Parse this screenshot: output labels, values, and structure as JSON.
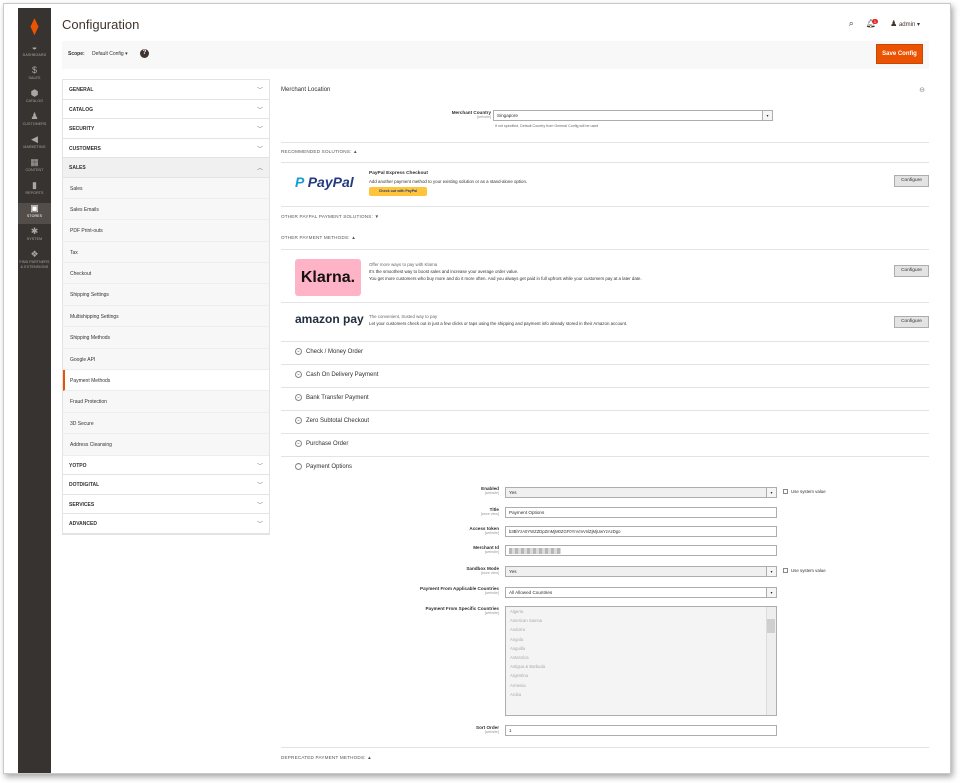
{
  "admin_nav": [
    {
      "icon": "dashboard-icon",
      "label": "DASHBOARD",
      "glyph": "◒"
    },
    {
      "icon": "sales-icon",
      "label": "SALES",
      "glyph": "$"
    },
    {
      "icon": "catalog-icon",
      "label": "CATALOG",
      "glyph": "⬢"
    },
    {
      "icon": "customers-icon",
      "label": "CUSTOMERS",
      "glyph": "♟"
    },
    {
      "icon": "marketing-icon",
      "label": "MARKETING",
      "glyph": "◀"
    },
    {
      "icon": "content-icon",
      "label": "CONTENT",
      "glyph": "▦"
    },
    {
      "icon": "reports-icon",
      "label": "REPORTS",
      "glyph": "▮"
    },
    {
      "icon": "stores-icon",
      "label": "STORES",
      "glyph": "▣"
    },
    {
      "icon": "system-icon",
      "label": "SYSTEM",
      "glyph": "✱"
    },
    {
      "icon": "partners-icon",
      "label": "FIND PARTNERS & EXTENSIONS",
      "glyph": "❖"
    }
  ],
  "header": {
    "title": "Configuration",
    "notifications_count": "1",
    "user": "admin"
  },
  "scope": {
    "label": "Scope:",
    "value": "Default Config",
    "save_label": "Save Config"
  },
  "config_nav": {
    "sections_top": [
      {
        "label": "GENERAL"
      },
      {
        "label": "CATALOG"
      },
      {
        "label": "SECURITY"
      },
      {
        "label": "CUSTOMERS"
      }
    ],
    "sales_label": "SALES",
    "sales_items": [
      "Sales",
      "Sales Emails",
      "PDF Print-outs",
      "Tax",
      "Checkout",
      "Shipping Settings",
      "Multishipping Settings",
      "Shipping Methods",
      "Google API",
      "Payment Methods",
      "Fraud Protection",
      "3D Secure",
      "Address Cleansing"
    ],
    "sections_bottom": [
      {
        "label": "YOTPO"
      },
      {
        "label": "DOTDIGITAL"
      },
      {
        "label": "SERVICES"
      },
      {
        "label": "ADVANCED"
      }
    ]
  },
  "main": {
    "merchant_location_title": "Merchant Location",
    "merchant_country_label": "Merchant Country",
    "merchant_country_scope": "[website]",
    "merchant_country_value": "Singapore",
    "merchant_country_note": "If not specified, Default Country from General Config will be used",
    "recommended_label": "RECOMMENDED SOLUTIONS: ▲",
    "paypal_logo": "PayPal",
    "paypal_title": "PayPal Express Checkout",
    "paypal_desc": "Add another payment method to your existing solution or as a stand-alone option.",
    "paypal_btn": "Check out with PayPal",
    "configure_label": "Configure",
    "other_paypal_label": "OTHER PAYPAL PAYMENT SOLUTIONS: ▼",
    "other_methods_label": "OTHER PAYMENT METHODS: ▲",
    "klarna_logo": "Klarna.",
    "klarna_line1": "Offer more ways to pay with Klarna",
    "klarna_line2": "It's the smoothest way to boost sales and increase your average order value.",
    "klarna_line3": "You get more customers who buy more and do it more often. And you always get paid in full upfront while your customers pay at a later date.",
    "amazon_logo": "amazon pay",
    "amazon_line1": "The convenient, trusted way to pay",
    "amazon_line2": "Let your customers check out in just a few clicks or taps using the shipping and payment info already stored in their Amazon account.",
    "collapsibles": [
      "Check / Money Order",
      "Cash On Delivery Payment",
      "Bank Transfer Payment",
      "Zero Subtotal Checkout",
      "Purchase Order",
      "Payment Options"
    ],
    "fields": {
      "enabled_label": "Enabled",
      "enabled_scope": "[website]",
      "enabled_value": "Yes",
      "title_label": "Title",
      "title_scope": "[store view]",
      "title_value": "Payment Options",
      "token_label": "Access token",
      "token_scope": "[website]",
      "token_value": "b3BlYzA0YWZZDpZmMjM0ZGF0YnVmVnlZjMjUwYzAzDgo",
      "merchant_id_label": "Merchant Id",
      "merchant_id_scope": "[website]",
      "sandbox_label": "Sandbox Mode",
      "sandbox_scope": "[store view]",
      "sandbox_value": "Yes",
      "applicable_label": "Payment From Applicable Countries",
      "applicable_scope": "[website]",
      "applicable_value": "All Allowed Countries",
      "specific_label": "Payment From Specific Countries",
      "specific_scope": "[website]",
      "sort_label": "Sort Order",
      "sort_scope": "[website]",
      "sort_value": "1",
      "use_system_value": "Use system value"
    },
    "countries": [
      "Algeria",
      "American Samoa",
      "Andorra",
      "Angola",
      "Anguilla",
      "Antarctica",
      "Antigua & Barbuda",
      "Argentina",
      "Armenia",
      "Aruba"
    ],
    "deprecated_label": "DEPRECATED PAYMENT METHODS: ▲"
  },
  "colors": {
    "accent": "#eb5202",
    "sidebar": "#373330",
    "paypal_blue": "#253b80",
    "paypal_light": "#179bd7",
    "klarna_pink": "#ffb3c7"
  }
}
